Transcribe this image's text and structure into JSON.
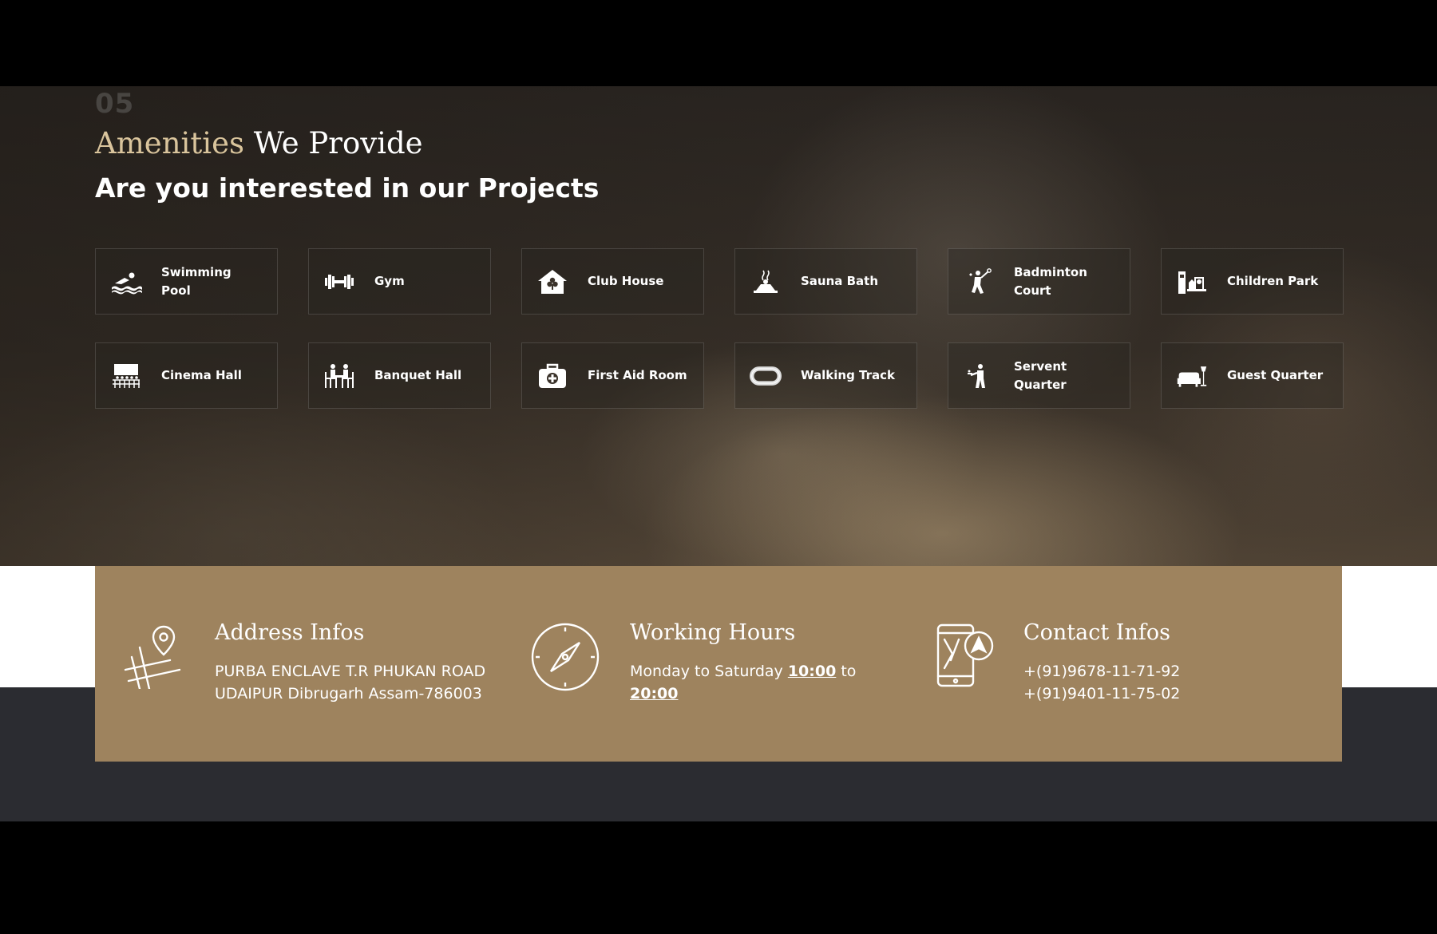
{
  "amenities_section": {
    "number": "05",
    "heading_accent": "Amenities",
    "heading_rest": " We Provide",
    "subheading": "Are you interested in our Projects",
    "items": [
      {
        "label": "Swimming Pool",
        "icon": "swimming-icon"
      },
      {
        "label": "Gym",
        "icon": "dumbbell-icon"
      },
      {
        "label": "Club House",
        "icon": "club-house-icon"
      },
      {
        "label": "Sauna Bath",
        "icon": "sauna-icon"
      },
      {
        "label": "Badminton Court",
        "icon": "badminton-icon"
      },
      {
        "label": "Children Park",
        "icon": "children-park-icon"
      },
      {
        "label": "Cinema Hall",
        "icon": "cinema-icon"
      },
      {
        "label": "Banquet Hall",
        "icon": "banquet-icon"
      },
      {
        "label": "First Aid Room",
        "icon": "first-aid-icon"
      },
      {
        "label": "Walking Track",
        "icon": "walking-track-icon"
      },
      {
        "label": "Servent Quarter",
        "icon": "servant-icon"
      },
      {
        "label": "Guest Quarter",
        "icon": "guest-sofa-icon"
      }
    ]
  },
  "info_band": {
    "address": {
      "title": "Address Infos",
      "line1": "PURBA ENCLAVE T.R PHUKAN ROAD",
      "line2": "UDAIPUR Dibrugarh Assam-786003"
    },
    "hours": {
      "title": "Working Hours",
      "prefix": "Monday to Saturday ",
      "open": "10:00",
      "mid": " to",
      "close": "20:00"
    },
    "contact": {
      "title": "Contact Infos",
      "phone1": "+(91)9678-11-71-92",
      "phone2": "+(91)9401-11-75-02"
    }
  },
  "colors": {
    "accent_gold": "#d9c49c",
    "band_brown": "#9e835e",
    "footer_dark": "#2b2c31"
  }
}
